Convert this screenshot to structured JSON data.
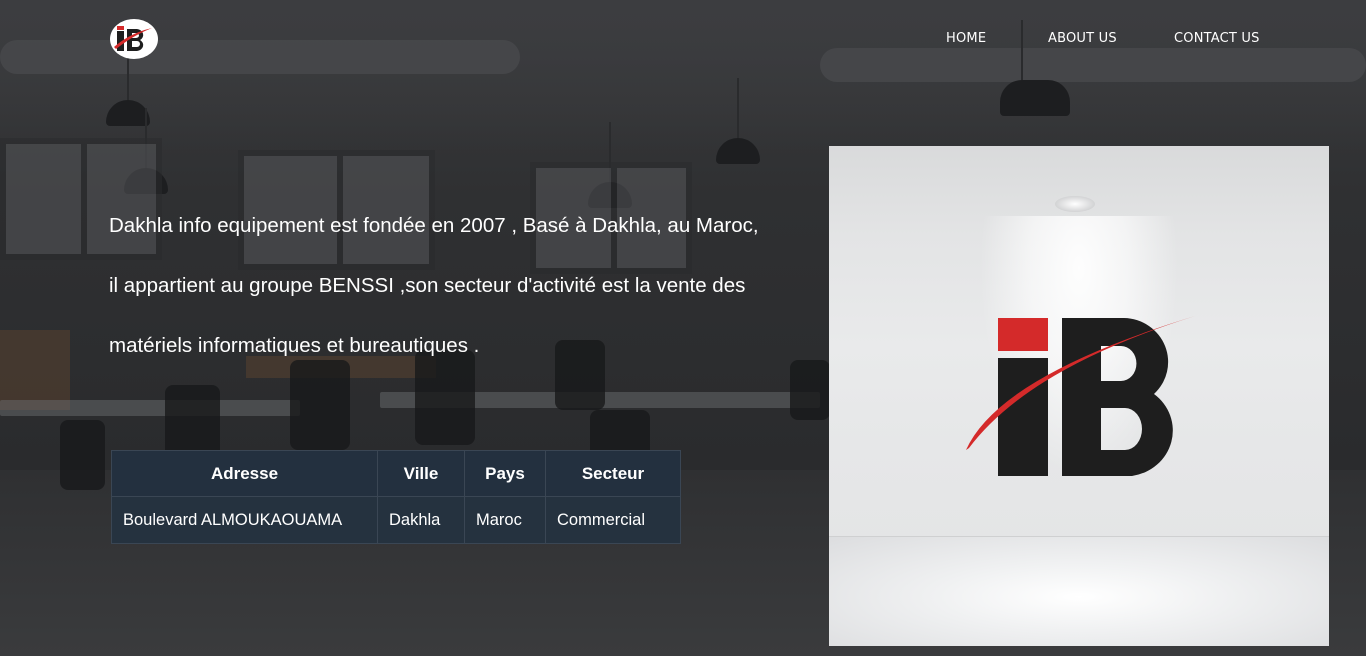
{
  "header": {
    "logo_text": "iB",
    "nav": [
      {
        "label": "HOME"
      },
      {
        "label": "ABOUT US"
      },
      {
        "label": "CONTACT US"
      }
    ]
  },
  "intro": {
    "lines": [
      "Dakhla info equipement est fondée en 2007 , Basé à Dakhla, au Maroc,",
      "il appartient au groupe BENSSI ,son secteur d'activité est la vente des",
      "matériels informatiques et bureautiques ."
    ]
  },
  "info_table": {
    "headers": [
      "Adresse",
      "Ville",
      "Pays",
      "Secteur"
    ],
    "row": [
      "Boulevard ALMOUKAOUAMA",
      "Dakhla",
      "Maroc",
      "Commercial"
    ]
  },
  "photo": {
    "logo_text": "iB"
  },
  "colors": {
    "brand_red": "#d42a2a",
    "brand_dark": "#1e1e1e",
    "table_bg": "#23303f"
  }
}
